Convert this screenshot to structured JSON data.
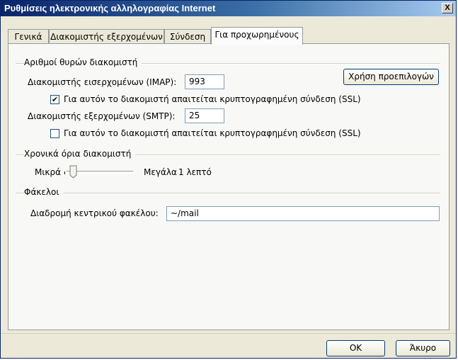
{
  "window": {
    "title": "Ρυθμίσεις ηλεκτρονικής αλληλογραφίας Internet",
    "close_label": "X"
  },
  "tabs": [
    {
      "label": "Γενικά",
      "active": false
    },
    {
      "label": "Διακομιστής εξερχομένων",
      "active": false
    },
    {
      "label": "Σύνδεση",
      "active": false
    },
    {
      "label": "Για προχωρημένους",
      "active": true
    }
  ],
  "ports": {
    "group_label": "Αριθμοί θυρών διακομιστή",
    "incoming_label": "Διακομιστής εισερχομένων (IMAP):",
    "incoming_value": "993",
    "incoming_ssl_label": "Για αυτόν το διακομιστή απαιτείται κρυπτογραφημένη σύνδεση (SSL)",
    "incoming_ssl_checked": true,
    "outgoing_label": "Διακομιστής εξερχομένων (SMTP):",
    "outgoing_value": "25",
    "outgoing_ssl_label": "Για αυτόν το διακομιστή απαιτείται κρυπτογραφημένη σύνδεση (SSL)",
    "outgoing_ssl_checked": false,
    "defaults_button": "Χρήση προεπιλογών"
  },
  "timeouts": {
    "group_label": "Χρονικά όρια διακομιστή",
    "min_label": "Μικρά",
    "max_label": "Μεγάλα",
    "value_text": "1 λεπτό",
    "slider_level": 0.1
  },
  "folders": {
    "group_label": "Φάκελοι",
    "root_label": "Διαδρομή κεντρικού φακέλου:",
    "root_value": "~/mail"
  },
  "footer": {
    "ok_label": "OK",
    "cancel_label": "Άκυρο"
  },
  "checkmark": "✔"
}
